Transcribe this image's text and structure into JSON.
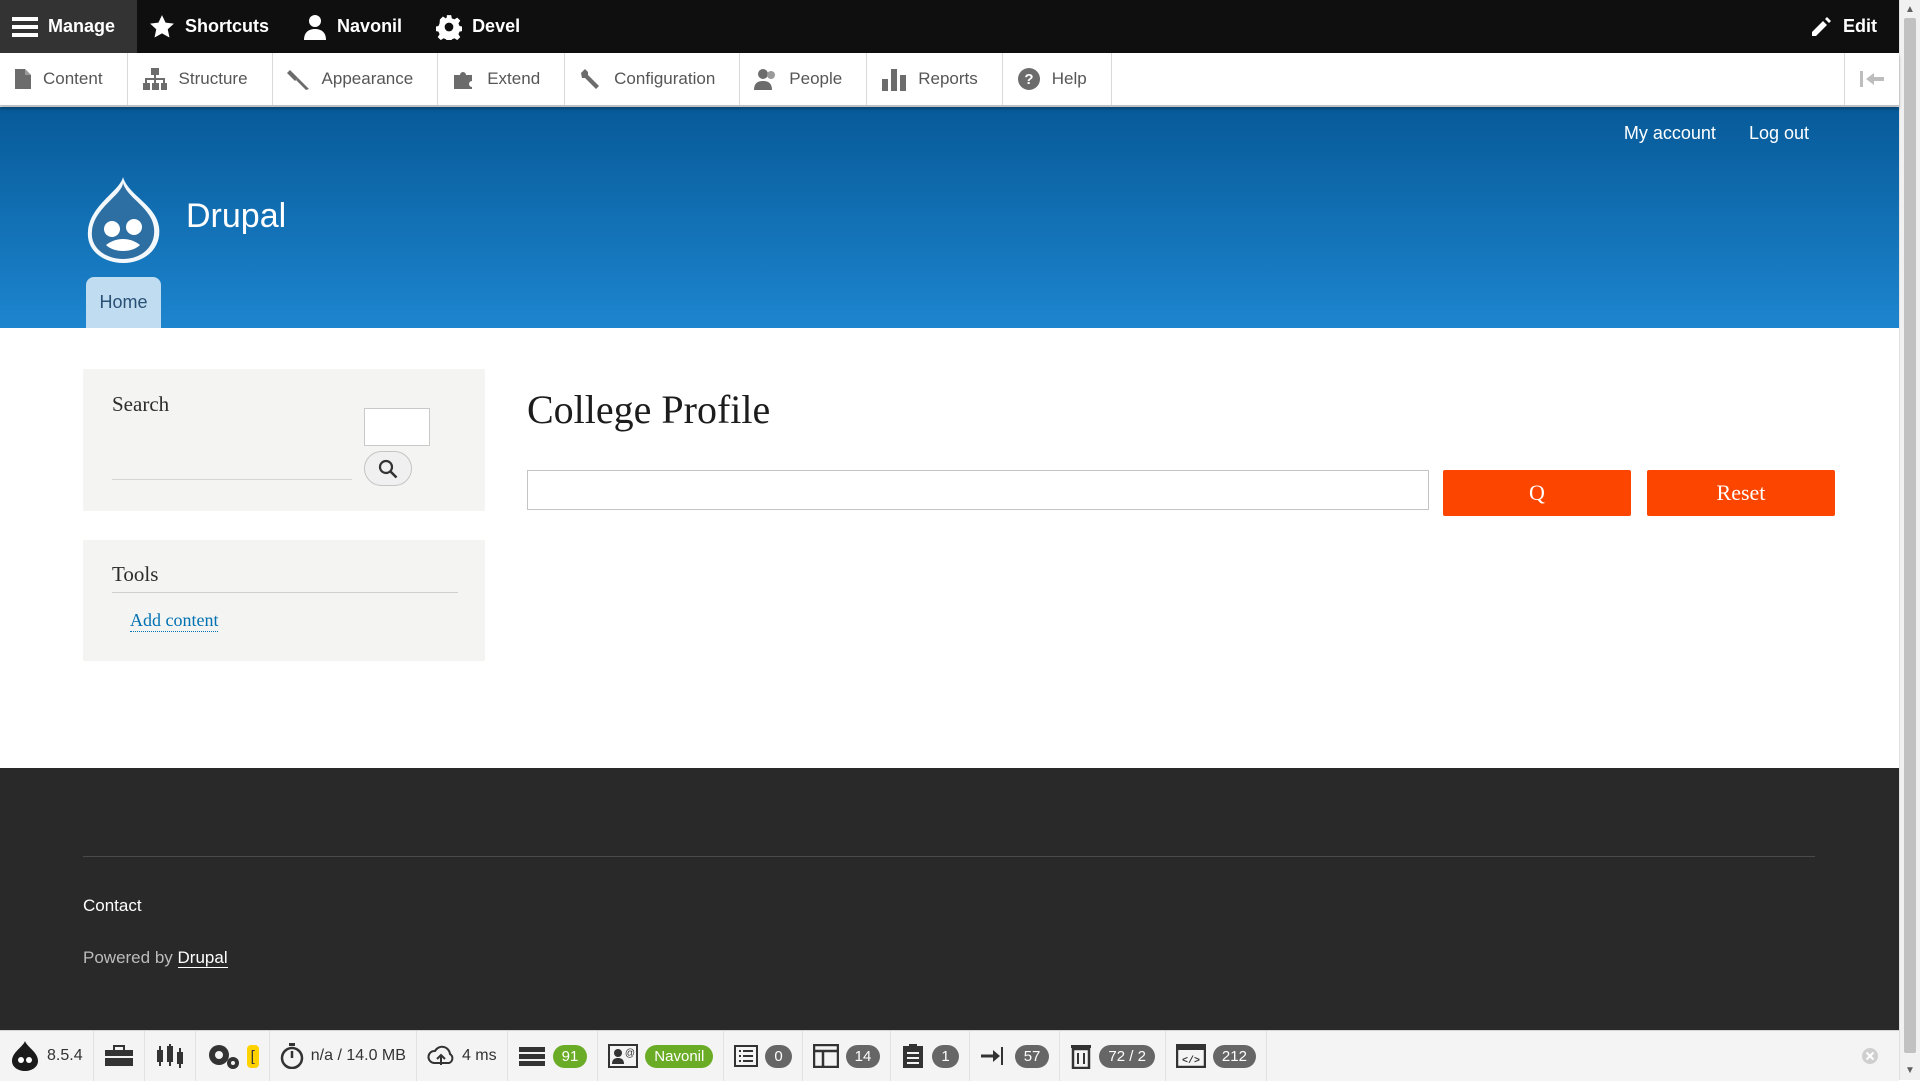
{
  "toolbar": {
    "manage": "Manage",
    "shortcuts": "Shortcuts",
    "user": "Navonil",
    "devel": "Devel",
    "edit": "Edit"
  },
  "tray": {
    "items": [
      "Content",
      "Structure",
      "Appearance",
      "Extend",
      "Configuration",
      "People",
      "Reports",
      "Help"
    ]
  },
  "header": {
    "my_account": "My account",
    "log_out": "Log out",
    "site_name": "Drupal",
    "home_tab": "Home"
  },
  "sidebar": {
    "search_title": "Search",
    "tools_title": "Tools",
    "add_content": "Add content"
  },
  "main": {
    "title": "College Profile",
    "search_button": "Q",
    "reset_button": "Reset"
  },
  "footer": {
    "contact": "Contact",
    "powered_by": "Powered by",
    "powered_link": "Drupal"
  },
  "profiler": {
    "version": "8.5.4",
    "php_badge": "[",
    "time_memory": "n/a / 14.0 MB",
    "ajax_time": "4 ms",
    "database_count": "91",
    "user": "Navonil",
    "views_count": "0",
    "blocks_count": "14",
    "forms_count": "1",
    "events_count": "57",
    "cache_count": "72 / 2",
    "assets_count": "212"
  },
  "colors": {
    "accent_orange": "#fc4600",
    "header_dark": "#075a98",
    "header_light": "#1d85cf",
    "footer": "#292929"
  }
}
